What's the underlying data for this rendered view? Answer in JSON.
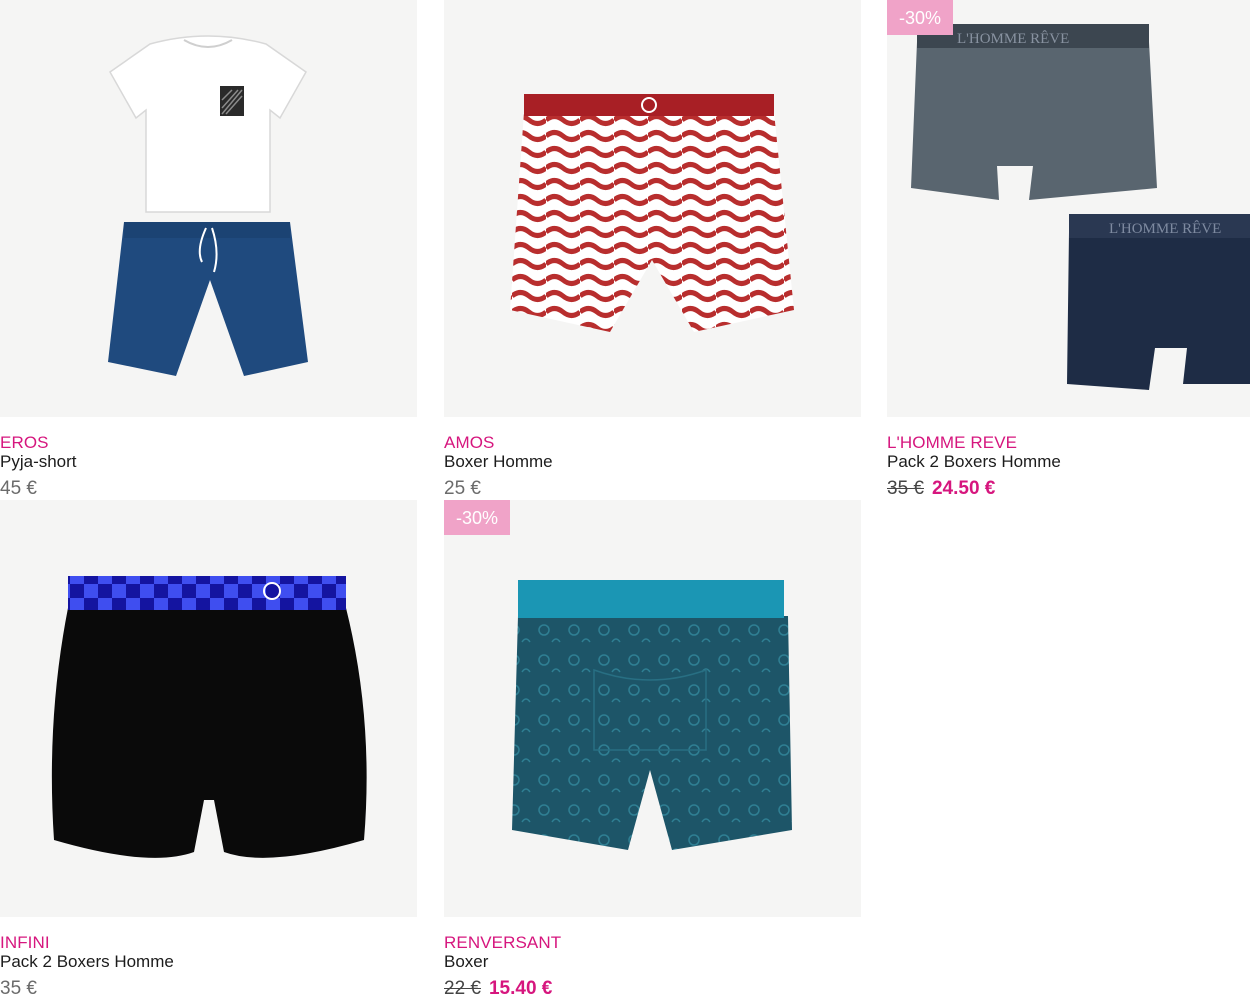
{
  "accent_color": "#d6167e",
  "badge_color": "#f0a3c8",
  "products": [
    {
      "brand": "EROS",
      "name": "Pyja-short",
      "price": "45 €",
      "icon": "pyjama-set-image"
    },
    {
      "brand": "AMOS",
      "name": "Boxer Homme",
      "price": "25 €",
      "icon": "wavy-boxer-image"
    },
    {
      "brand": "L'HOMME REVE",
      "name": "Pack 2 Boxers Homme",
      "old_price": "35 €",
      "sale_price": "24.50 €",
      "badge": "-30%",
      "waistband_text": "L'HOMME RÊVE",
      "icon": "two-boxers-image"
    },
    {
      "brand": "INFINI",
      "name": "Pack 2 Boxers Homme",
      "price": "35 €",
      "icon": "black-boxer-image"
    },
    {
      "brand": "RENVERSANT",
      "name": "Boxer",
      "old_price": "22 €",
      "sale_price": "15.40 €",
      "badge": "-30%",
      "icon": "teal-boxer-image"
    }
  ]
}
